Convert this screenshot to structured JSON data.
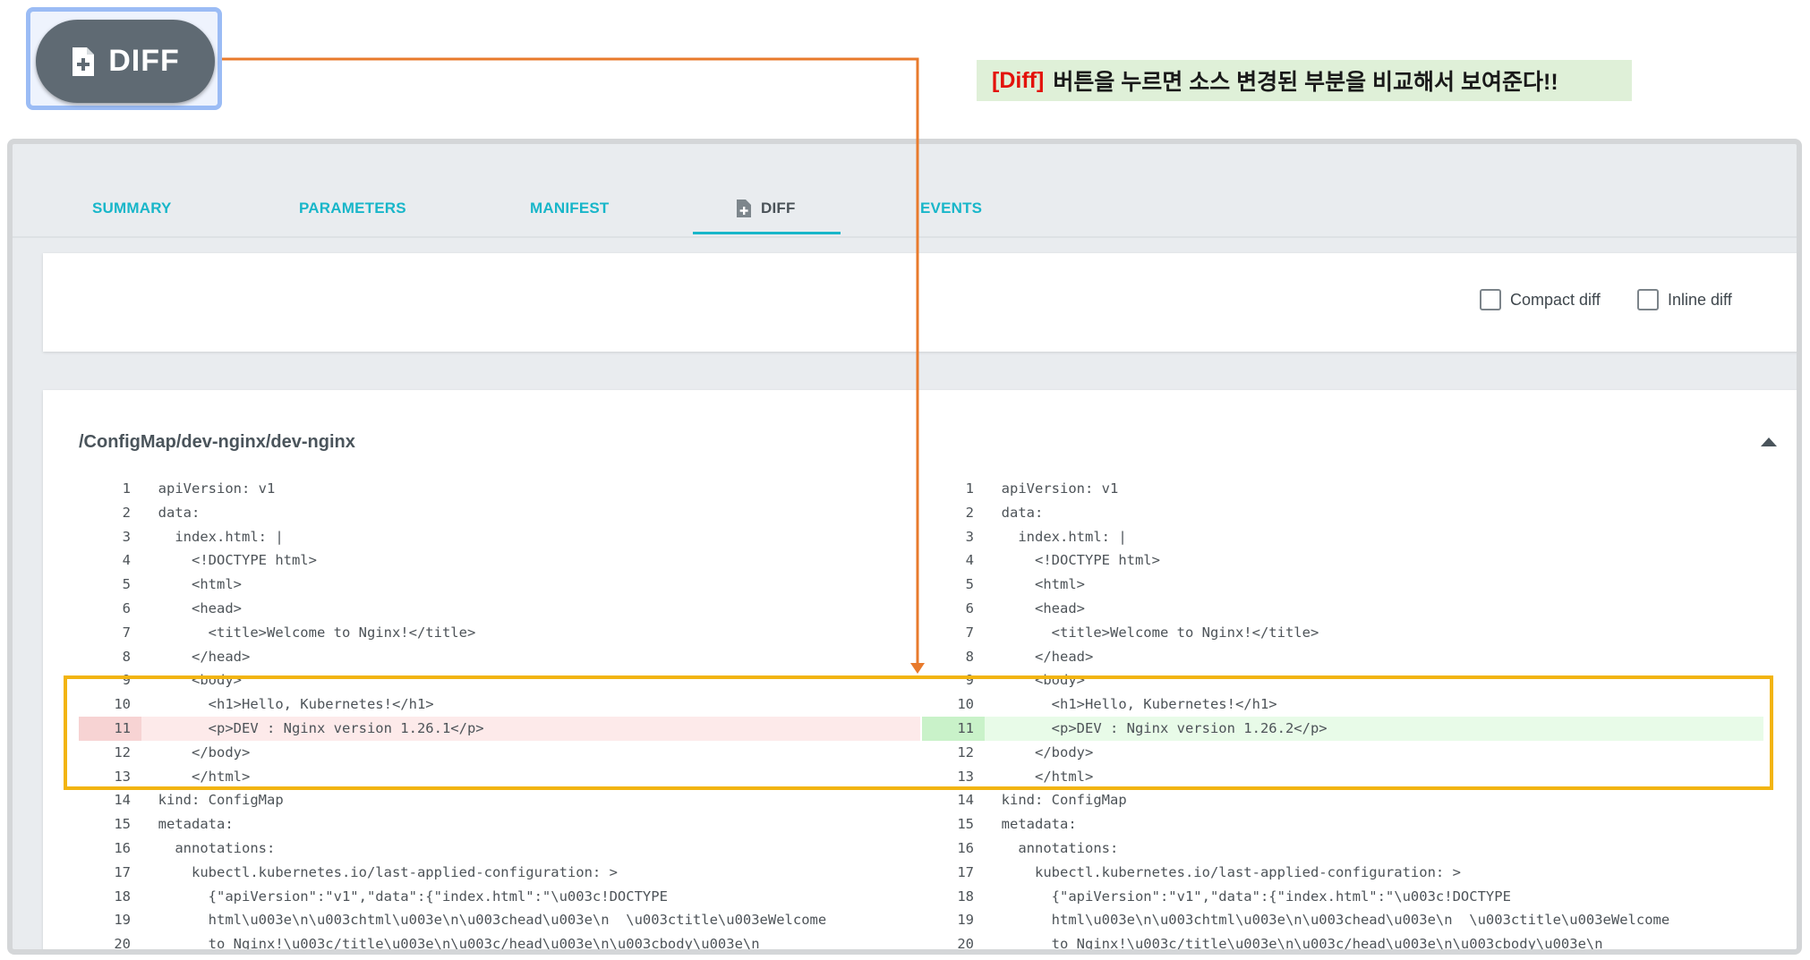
{
  "top_button": {
    "label": "DIFF",
    "icon": "file-plus-icon"
  },
  "callout": {
    "highlight": "[Diff]",
    "text": "버튼을 누르면 소스 변경된 부분을 비교해서 보여준다!!"
  },
  "tabs": [
    {
      "label": "SUMMARY"
    },
    {
      "label": "PARAMETERS"
    },
    {
      "label": "MANIFEST"
    },
    {
      "label": "DIFF",
      "icon": "file-plus-icon",
      "active": true
    },
    {
      "label": "EVENTS"
    }
  ],
  "options": {
    "compact_label": "Compact diff",
    "inline_label": "Inline diff"
  },
  "resource": {
    "title": "/ConfigMap/dev-nginx/dev-nginx"
  },
  "left_lines": [
    {
      "n": "1",
      "t": "apiVersion: v1"
    },
    {
      "n": "2",
      "t": "data:"
    },
    {
      "n": "3",
      "t": "  index.html: |"
    },
    {
      "n": "4",
      "t": "    <!DOCTYPE html>"
    },
    {
      "n": "5",
      "t": "    <html>"
    },
    {
      "n": "6",
      "t": "    <head>"
    },
    {
      "n": "7",
      "t": "      <title>Welcome to Nginx!</title>"
    },
    {
      "n": "8",
      "t": "    </head>"
    },
    {
      "n": "9",
      "t": "    <body>"
    },
    {
      "n": "10",
      "t": "      <h1>Hello, Kubernetes!</h1>"
    },
    {
      "n": "11",
      "t": "      <p>DEV : Nginx version 1.26.1</p>",
      "state": "del"
    },
    {
      "n": "12",
      "t": "    </body>"
    },
    {
      "n": "13",
      "t": "    </html>"
    },
    {
      "n": "14",
      "t": "kind: ConfigMap"
    },
    {
      "n": "15",
      "t": "metadata:"
    },
    {
      "n": "16",
      "t": "  annotations:"
    },
    {
      "n": "17",
      "t": "    kubectl.kubernetes.io/last-applied-configuration: >"
    },
    {
      "n": "18",
      "t": "      {\"apiVersion\":\"v1\",\"data\":{\"index.html\":\"\\u003c!DOCTYPE"
    },
    {
      "n": "19",
      "t": "      html\\u003e\\n\\u003chtml\\u003e\\n\\u003chead\\u003e\\n  \\u003ctitle\\u003eWelcome"
    },
    {
      "n": "20",
      "t": "      to Nginx!\\u003c/title\\u003e\\n\\u003c/head\\u003e\\n\\u003cbody\\u003e\\n"
    }
  ],
  "right_lines": [
    {
      "n": "1",
      "t": "apiVersion: v1"
    },
    {
      "n": "2",
      "t": "data:"
    },
    {
      "n": "3",
      "t": "  index.html: |"
    },
    {
      "n": "4",
      "t": "    <!DOCTYPE html>"
    },
    {
      "n": "5",
      "t": "    <html>"
    },
    {
      "n": "6",
      "t": "    <head>"
    },
    {
      "n": "7",
      "t": "      <title>Welcome to Nginx!</title>"
    },
    {
      "n": "8",
      "t": "    </head>"
    },
    {
      "n": "9",
      "t": "    <body>"
    },
    {
      "n": "10",
      "t": "      <h1>Hello, Kubernetes!</h1>"
    },
    {
      "n": "11",
      "t": "      <p>DEV : Nginx version 1.26.2</p>",
      "state": "add"
    },
    {
      "n": "12",
      "t": "    </body>"
    },
    {
      "n": "13",
      "t": "    </html>"
    },
    {
      "n": "14",
      "t": "kind: ConfigMap"
    },
    {
      "n": "15",
      "t": "metadata:"
    },
    {
      "n": "16",
      "t": "  annotations:"
    },
    {
      "n": "17",
      "t": "    kubectl.kubernetes.io/last-applied-configuration: >"
    },
    {
      "n": "18",
      "t": "      {\"apiVersion\":\"v1\",\"data\":{\"index.html\":\"\\u003c!DOCTYPE"
    },
    {
      "n": "19",
      "t": "      html\\u003e\\n\\u003chtml\\u003e\\n\\u003chead\\u003e\\n  \\u003ctitle\\u003eWelcome"
    },
    {
      "n": "20",
      "t": "      to Nginx!\\u003c/title\\u003e\\n\\u003c/head\\u003e\\n\\u003cbody\\u003e\\n"
    }
  ],
  "colors": {
    "accent": "#18b6c9",
    "arrow": "#e87a2c",
    "highlight_box": "#f2b410",
    "deleted_bg": "#fdeaea",
    "added_bg": "#e8fbe8"
  }
}
